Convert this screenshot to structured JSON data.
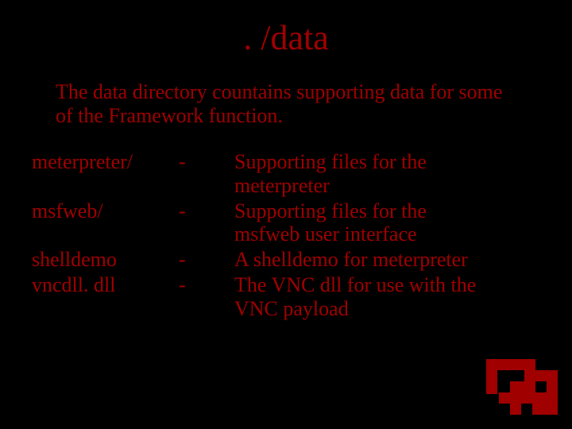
{
  "title": ". /data",
  "intro": "The data directory countains supporting data for some of the Framework function.",
  "rows": [
    {
      "name": "meterpreter/",
      "dash": "-",
      "desc": "Supporting files for the meterpreter"
    },
    {
      "name": "msfweb/",
      "dash": "-",
      "desc": "Supporting files for the msfweb user interface"
    },
    {
      "name": "shelldemo",
      "dash": "-",
      "desc": "A shelldemo for meterpreter"
    },
    {
      "name": "vncdll. dll",
      "dash": "-",
      "desc": "The VNC dll for use with the VNC payload"
    }
  ]
}
